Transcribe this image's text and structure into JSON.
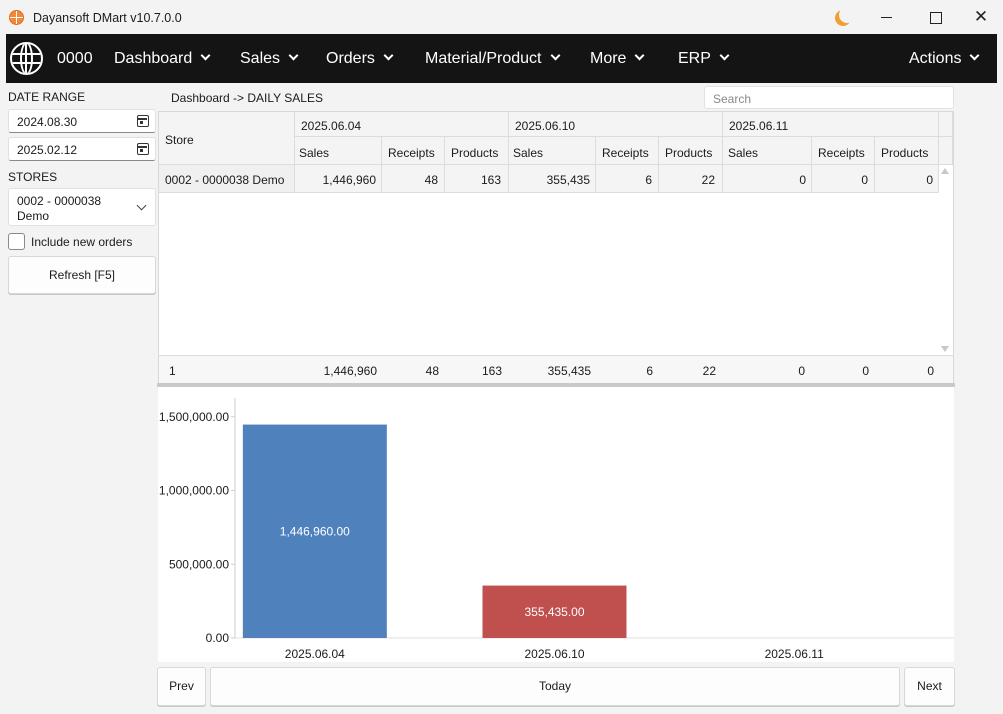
{
  "window": {
    "title": "Dayansoft DMart v10.7.0.0"
  },
  "menubar": {
    "code": "0000",
    "items": [
      {
        "label": "Dashboard"
      },
      {
        "label": "Sales"
      },
      {
        "label": "Orders"
      },
      {
        "label": "Material/Product"
      },
      {
        "label": "More"
      },
      {
        "label": "ERP"
      },
      {
        "label": "Actions"
      }
    ]
  },
  "sidebar": {
    "date_range_label": "DATE RANGE",
    "date_from": "2024.08.30",
    "date_to": "2025.02.12",
    "stores_label": "STORES",
    "store_line1": "0002 - 0000038",
    "store_line2": "Demo",
    "include_new_orders": "Include new orders",
    "include_new_orders_checked": false,
    "refresh_label": "Refresh [F5]"
  },
  "main": {
    "breadcrumb": "Dashboard -> DAILY SALES",
    "search_placeholder": "Search"
  },
  "grid": {
    "store_header": "Store",
    "dates": [
      "2025.06.04",
      "2025.06.10",
      "2025.06.11"
    ],
    "sub_headers": [
      "Sales",
      "Receipts",
      "Products"
    ],
    "rows": [
      {
        "store": "0002 - 0000038 Demo",
        "values": [
          "1,446,960",
          "48",
          "163",
          "355,435",
          "6",
          "22",
          "0",
          "0",
          "0"
        ]
      }
    ],
    "footer": {
      "count": "1",
      "values": [
        "1,446,960",
        "48",
        "163",
        "355,435",
        "6",
        "22",
        "0",
        "0",
        "0"
      ]
    }
  },
  "chart_data": {
    "type": "bar",
    "categories": [
      "2025.06.04",
      "2025.06.10",
      "2025.06.11"
    ],
    "values": [
      1446960,
      355435,
      0
    ],
    "data_labels": [
      "1,446,960.00",
      "355,435.00",
      ""
    ],
    "colors": [
      "#4f81bd",
      "#c0504d",
      "#9bbb59"
    ],
    "ylim": [
      0,
      1600000
    ],
    "yticks": [
      0,
      500000,
      1000000,
      1500000
    ],
    "ytick_labels": [
      "0.00",
      "500,000.00",
      "1,000,000.00",
      "1,500,000.00"
    ],
    "title": "",
    "xlabel": "",
    "ylabel": "",
    "grid": false
  },
  "bottom": {
    "prev": "Prev",
    "today": "Today",
    "next": "Next"
  }
}
